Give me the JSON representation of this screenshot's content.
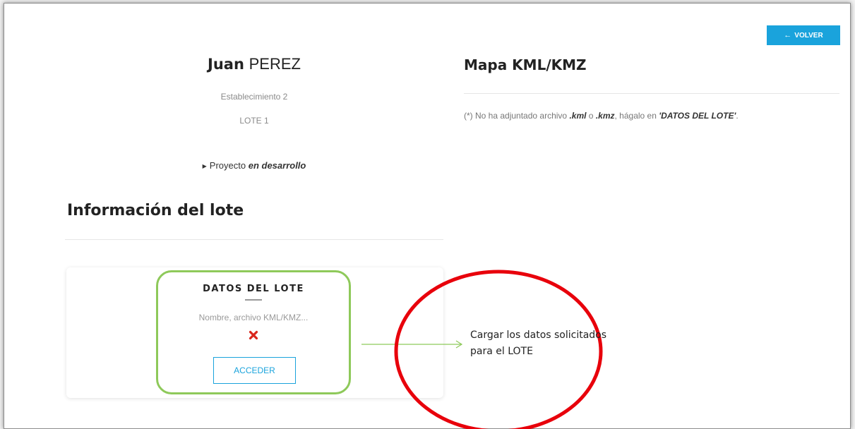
{
  "header": {
    "back_label": "VOLVER",
    "back_icon": "arrow-left-icon"
  },
  "profile": {
    "first_name": "Juan",
    "last_name": "PEREZ",
    "establecimiento": "Establecimiento 2",
    "lote": "LOTE 1",
    "proyecto_prefix": "Proyecto",
    "proyecto_status": "en desarrollo"
  },
  "info": {
    "title": "Información del lote"
  },
  "mapa": {
    "title": "Mapa KML/KMZ",
    "note_prefix": "(*) No ha adjuntado archivo",
    "note_kml": ".kml",
    "note_o": "o",
    "note_kmz": ".kmz",
    "note_middle": ", hágalo en",
    "note_target": "'DATOS DEL LOTE'",
    "note_end": "."
  },
  "datos_card": {
    "title": "DATOS DEL LOTE",
    "subtitle": "Nombre, archivo KML/KMZ...",
    "status_icon": "x-icon",
    "status_color": "#d9261c",
    "button_label": "ACCEDER"
  },
  "annotation": {
    "text": "Cargar los datos solicitados para el LOTE",
    "ellipse_color": "#e8000b",
    "highlight_color": "#8ec95a"
  },
  "colors": {
    "accent": "#1aa3dc"
  }
}
